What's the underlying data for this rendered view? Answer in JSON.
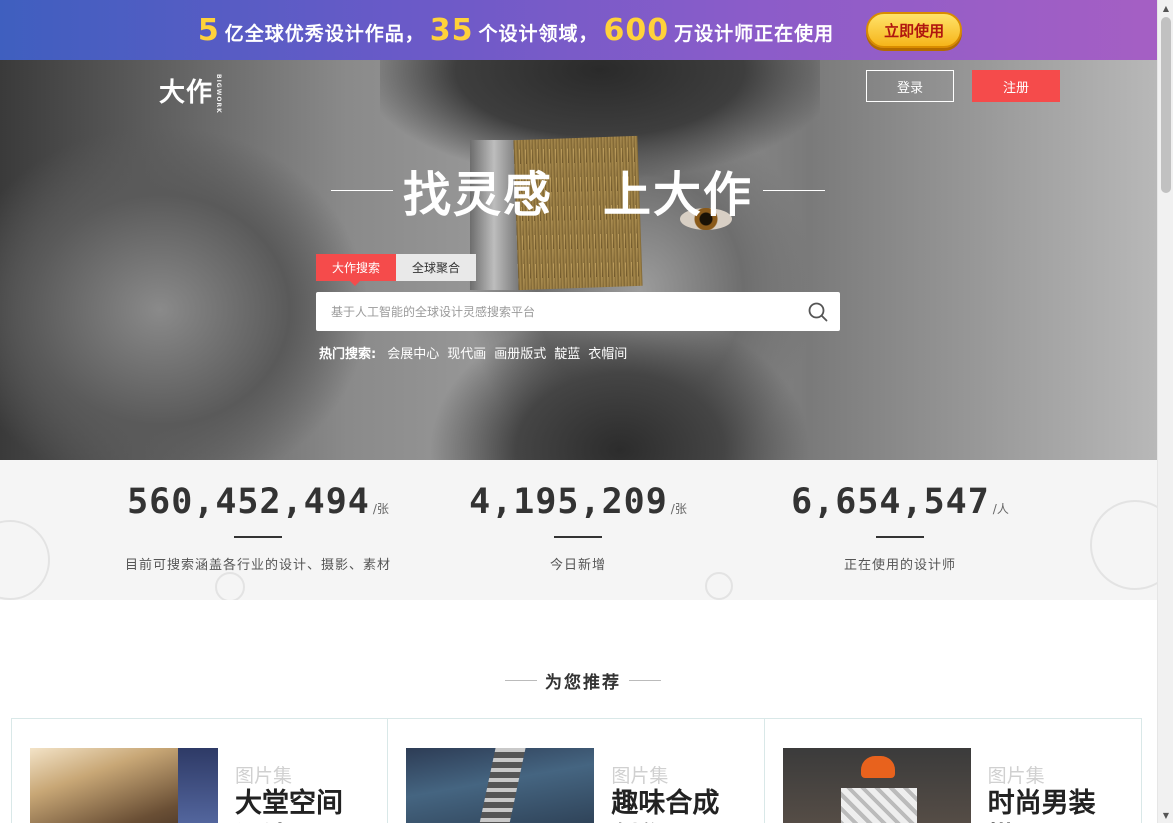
{
  "promo": {
    "segments": [
      {
        "num": "5",
        "text": "亿全球优秀设计作品，"
      },
      {
        "num": "35",
        "text": "个设计领域，"
      },
      {
        "num": "600",
        "text": "万设计师正在使用"
      }
    ],
    "cta_label": "立即使用",
    "colors": {
      "highlight": "#ffd23a",
      "cta_text": "#b0150f"
    }
  },
  "header": {
    "logo_text": "大作",
    "logo_sub": "BIGWORK",
    "login_label": "登录",
    "register_label": "注册",
    "accent_color": "#f54b4b"
  },
  "hero": {
    "slogan_left": "找灵感",
    "slogan_right": "上大作",
    "tabs": [
      {
        "label": "大作搜索",
        "active": true
      },
      {
        "label": "全球聚合",
        "active": false
      }
    ],
    "search": {
      "placeholder": "基于人工智能的全球设计灵感搜索平台",
      "value": "",
      "icon": "search-icon"
    },
    "hot": {
      "label": "热门搜索:",
      "keywords": [
        "会展中心",
        "现代画",
        "画册版式",
        "靛蓝",
        "衣帽间"
      ]
    }
  },
  "stats": [
    {
      "num": "560,452,494",
      "unit": "/张",
      "desc": "目前可搜索涵盖各行业的设计、摄影、素材"
    },
    {
      "num": "4,195,209",
      "unit": "/张",
      "desc": "今日新增"
    },
    {
      "num": "6,654,547",
      "unit": "/人",
      "desc": "正在使用的设计师"
    }
  ],
  "recommend": {
    "title": "为您推荐",
    "cards": [
      {
        "type": "图片集",
        "title": "大堂空间设计"
      },
      {
        "type": "图片集",
        "title": "趣味合成创作"
      },
      {
        "type": "图片集",
        "title": "时尚男装搭配"
      }
    ]
  }
}
